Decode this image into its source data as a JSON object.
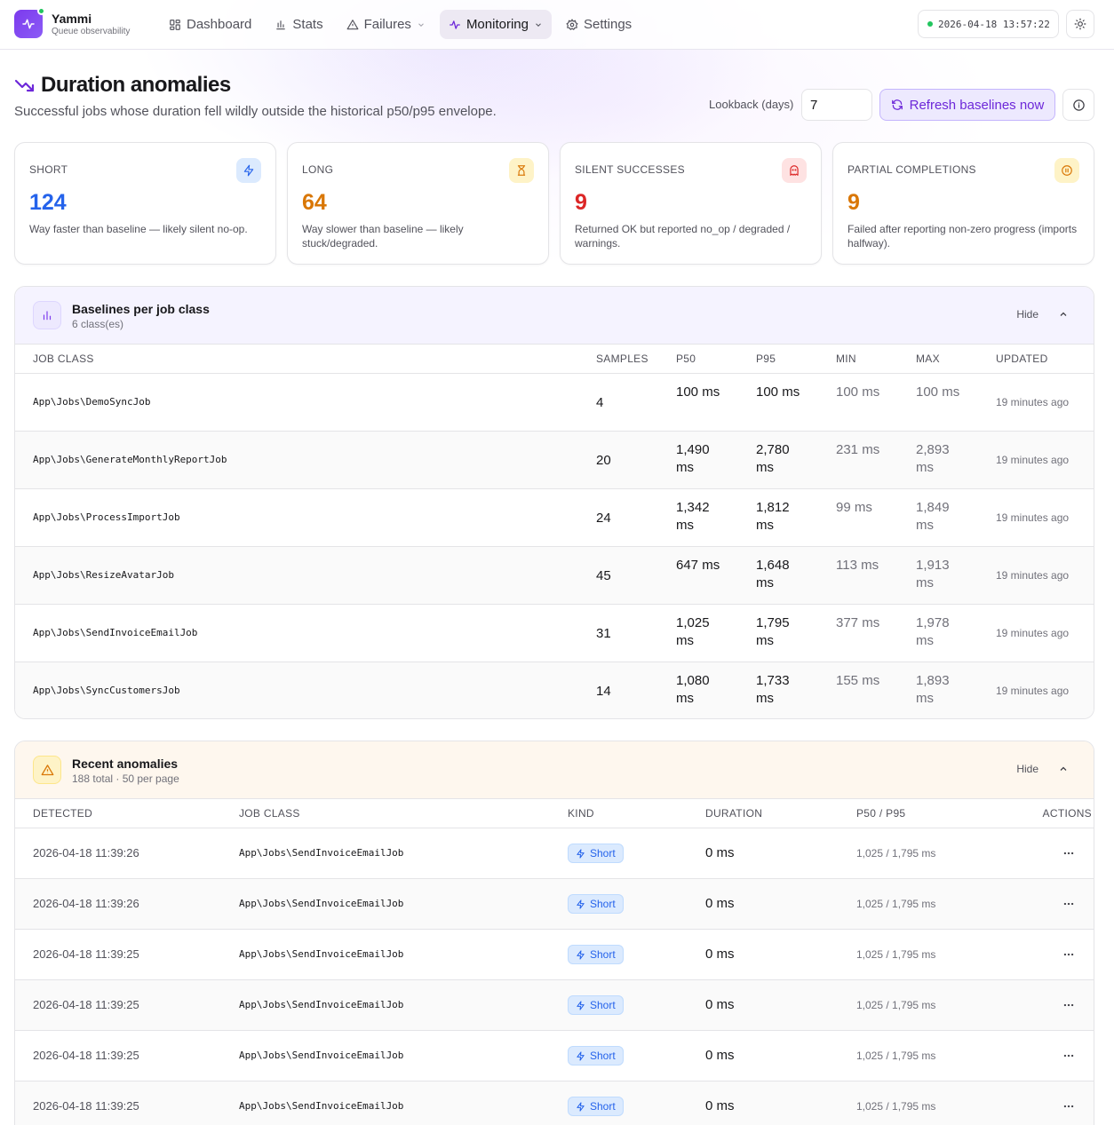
{
  "brand": {
    "name": "Yammi",
    "tagline": "Queue observability"
  },
  "nav": {
    "dashboard": "Dashboard",
    "stats": "Stats",
    "failures": "Failures",
    "monitoring": "Monitoring",
    "settings": "Settings"
  },
  "clock": "2026-04-18 13:57:22",
  "page": {
    "title": "Duration anomalies",
    "subtitle": "Successful jobs whose duration fell wildly outside the historical p50/p95 envelope.",
    "lookback_label": "Lookback (days)",
    "lookback_value": "7",
    "refresh_label": "Refresh baselines now"
  },
  "cards": [
    {
      "label": "SHORT",
      "value": "124",
      "desc": "Way faster than baseline — likely silent no-op.",
      "color": "#2563eb",
      "icon": "zap-icon"
    },
    {
      "label": "LONG",
      "value": "64",
      "desc": "Way slower than baseline — likely stuck/degraded.",
      "color": "#d97706",
      "icon": "hourglass-icon"
    },
    {
      "label": "SILENT SUCCESSES",
      "value": "9",
      "desc": "Returned OK but reported no_op / degraded / warnings.",
      "color": "#dc2626",
      "icon": "ghost-icon"
    },
    {
      "label": "PARTIAL COMPLETIONS",
      "value": "9",
      "desc": "Failed after reporting non-zero progress (imports halfway).",
      "color": "#d97706",
      "icon": "pause-circle-icon"
    }
  ],
  "baselines": {
    "title": "Baselines per job class",
    "subtitle": "6 class(es)",
    "hide_label": "Hide",
    "columns": {
      "job_class": "JOB CLASS",
      "samples": "SAMPLES",
      "p50": "P50",
      "p95": "P95",
      "min": "MIN",
      "max": "MAX",
      "updated": "UPDATED"
    },
    "rows": [
      {
        "job_class": "App\\Jobs\\DemoSyncJob",
        "samples": "4",
        "p50": "100 ms",
        "p95": "100 ms",
        "min": "100 ms",
        "max": "100 ms",
        "updated": "19 minutes ago"
      },
      {
        "job_class": "App\\Jobs\\GenerateMonthlyReportJob",
        "samples": "20",
        "p50": "1,490 ms",
        "p95": "2,780 ms",
        "min": "231 ms",
        "max": "2,893 ms",
        "updated": "19 minutes ago"
      },
      {
        "job_class": "App\\Jobs\\ProcessImportJob",
        "samples": "24",
        "p50": "1,342 ms",
        "p95": "1,812 ms",
        "min": "99 ms",
        "max": "1,849 ms",
        "updated": "19 minutes ago"
      },
      {
        "job_class": "App\\Jobs\\ResizeAvatarJob",
        "samples": "45",
        "p50": "647 ms",
        "p95": "1,648 ms",
        "min": "113 ms",
        "max": "1,913 ms",
        "updated": "19 minutes ago"
      },
      {
        "job_class": "App\\Jobs\\SendInvoiceEmailJob",
        "samples": "31",
        "p50": "1,025 ms",
        "p95": "1,795 ms",
        "min": "377 ms",
        "max": "1,978 ms",
        "updated": "19 minutes ago"
      },
      {
        "job_class": "App\\Jobs\\SyncCustomersJob",
        "samples": "14",
        "p50": "1,080 ms",
        "p95": "1,733 ms",
        "min": "155 ms",
        "max": "1,893 ms",
        "updated": "19 minutes ago"
      }
    ]
  },
  "anomalies": {
    "title": "Recent anomalies",
    "subtitle": "188 total · 50 per page",
    "hide_label": "Hide",
    "columns": {
      "detected": "DETECTED",
      "job_class": "JOB CLASS",
      "kind": "KIND",
      "duration": "DURATION",
      "p50_p95": "P50 / P95",
      "actions": "ACTIONS"
    },
    "rows": [
      {
        "detected": "2026-04-18 11:39:26",
        "job_class": "App\\Jobs\\SendInvoiceEmailJob",
        "kind": "Short",
        "duration": "0 ms",
        "p50_p95": "1,025 / 1,795 ms"
      },
      {
        "detected": "2026-04-18 11:39:26",
        "job_class": "App\\Jobs\\SendInvoiceEmailJob",
        "kind": "Short",
        "duration": "0 ms",
        "p50_p95": "1,025 / 1,795 ms"
      },
      {
        "detected": "2026-04-18 11:39:25",
        "job_class": "App\\Jobs\\SendInvoiceEmailJob",
        "kind": "Short",
        "duration": "0 ms",
        "p50_p95": "1,025 / 1,795 ms"
      },
      {
        "detected": "2026-04-18 11:39:25",
        "job_class": "App\\Jobs\\SendInvoiceEmailJob",
        "kind": "Short",
        "duration": "0 ms",
        "p50_p95": "1,025 / 1,795 ms"
      },
      {
        "detected": "2026-04-18 11:39:25",
        "job_class": "App\\Jobs\\SendInvoiceEmailJob",
        "kind": "Short",
        "duration": "0 ms",
        "p50_p95": "1,025 / 1,795 ms"
      },
      {
        "detected": "2026-04-18 11:39:25",
        "job_class": "App\\Jobs\\SendInvoiceEmailJob",
        "kind": "Short",
        "duration": "0 ms",
        "p50_p95": "1,025 / 1,795 ms"
      }
    ]
  }
}
